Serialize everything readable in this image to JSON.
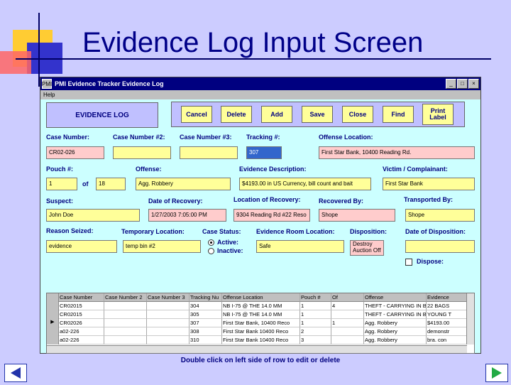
{
  "slide": {
    "title": "Evidence Log Input Screen"
  },
  "window": {
    "title": "PMI Evidence Tracker Evidence Log",
    "app_icon": "PMI",
    "controls": {
      "min": "_",
      "max": "□",
      "close": "×"
    },
    "menu": "Help"
  },
  "toolbar": {
    "logo": "EVIDENCE LOG",
    "cancel": "Cancel",
    "delete": "Delete",
    "add": "Add",
    "save": "Save",
    "close": "Close",
    "find": "Find",
    "print": "Print Label"
  },
  "form": {
    "case_number_label": "Case Number:",
    "case_number": "CR02-026",
    "case_number2_label": "Case Number #2:",
    "case_number2": "",
    "case_number3_label": "Case Number #3:",
    "case_number3": "",
    "tracking_label": "Tracking #:",
    "tracking": "307",
    "offense_location_label": "Offense Location:",
    "offense_location": "First Star Bank, 10400 Reading Rd.",
    "pouch_label": "Pouch #:",
    "pouch": "1",
    "of_label": "of",
    "pouch_of": "18",
    "offense_label": "Offense:",
    "offense": "Agg. Robbery",
    "evidence_desc_label": "Evidence Description:",
    "evidence_desc": "$4193.00 in US Currency, bill count and bait",
    "victim_label": "Victim / Complainant:",
    "victim": "First Star Bank",
    "suspect_label": "Suspect:",
    "suspect": "John Doe",
    "recovery_date_label": "Date of Recovery:",
    "recovery_date": "1/27/2003 7:05:00 PM",
    "recovery_loc_label": "Location of Recovery:",
    "recovery_loc": "9304 Reading Rd #22 Reso",
    "recovered_by_label": "Recovered By:",
    "recovered_by": "Shope",
    "transported_by_label": "Transported By:",
    "transported_by": "Shope",
    "reason_label": "Reason Seized:",
    "reason": "evidence",
    "temp_loc_label": "Temporary Location:",
    "temp_loc": "temp bin #2",
    "case_status_label": "Case Status:",
    "active": "Active:",
    "inactive": "Inactive:",
    "room_loc_label": "Evidence Room Location:",
    "room_loc": "Safe",
    "disposition_label": "Disposition:",
    "disposition_opt1": "Destroy",
    "disposition_opt2": "Auction Off",
    "disposition_date_label": "Date of Disposition:",
    "disposition_date": "",
    "dispose_label": "Dispose:"
  },
  "grid": {
    "columns": [
      "Case Number",
      "Case Number 2",
      "Case Number 3",
      "Tracking Nu",
      "Offense Location",
      "Pouch #",
      "Of",
      "Offense",
      "Evidence"
    ],
    "rows": [
      [
        "CR02015",
        "",
        "",
        "304",
        "NB I-75 @ THE 14.0 MM",
        "1",
        "4",
        "THEFT - CARRYING IN B",
        "22 BAGS"
      ],
      [
        "CR02015",
        "",
        "",
        "305",
        "NB I-75 @ THE 14.0 MM",
        "1",
        "",
        "THEFT - CARRYING IN B",
        "YOUNG T"
      ],
      [
        "CR02026",
        "",
        "",
        "307",
        "First Star Bank, 10400 Reco",
        "1",
        "1",
        "Agg. Robbery",
        "$4193.00"
      ],
      [
        "a02-226",
        "",
        "",
        "308",
        "First Star Bank 10400 Reco",
        "2",
        "",
        "Agg. Robbery",
        "demonstr"
      ],
      [
        "a02-226",
        "",
        "",
        "310",
        "First Star Bank 10400 Reco",
        "3",
        "",
        "Agg. Robbery",
        "bra. con"
      ]
    ]
  },
  "hint": "Double click on left side of row to edit or delete"
}
